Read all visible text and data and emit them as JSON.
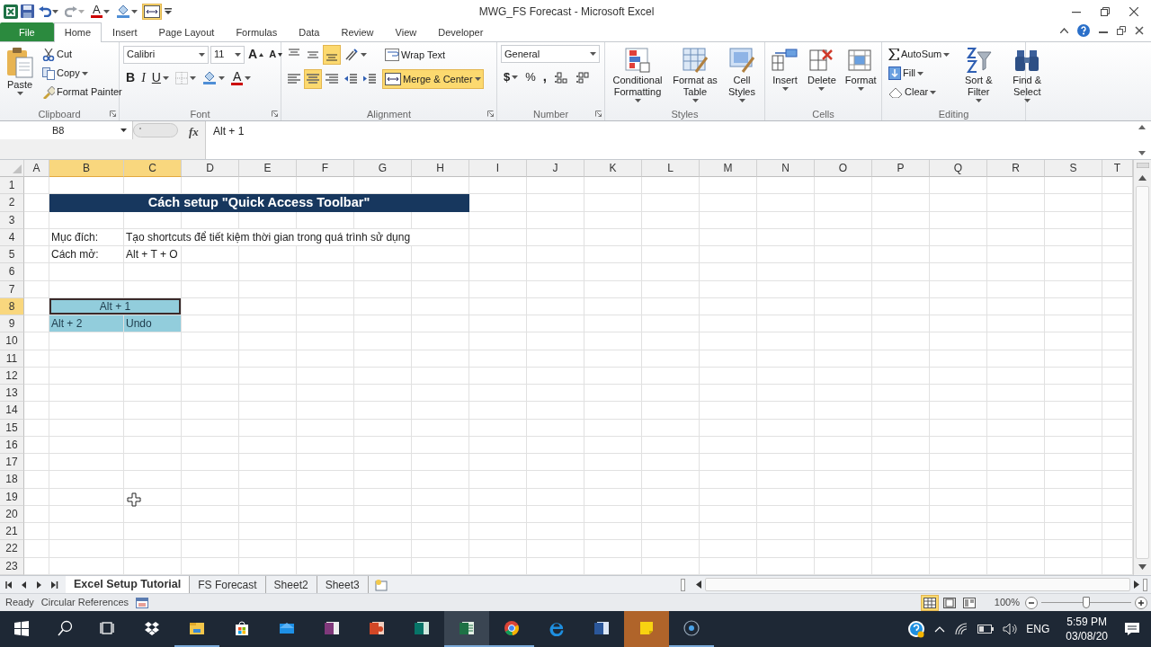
{
  "title_bar": {
    "font_color_glyph": "A",
    "title": "MWG_FS Forecast - Microsoft Excel"
  },
  "menu_tabs": [
    {
      "label": "File",
      "kind": "file",
      "selected": false
    },
    {
      "label": "Home",
      "kind": "tab",
      "selected": true
    },
    {
      "label": "Insert",
      "kind": "tab",
      "selected": false
    },
    {
      "label": "Page Layout",
      "kind": "tab",
      "selected": false
    },
    {
      "label": "Formulas",
      "kind": "tab",
      "selected": false
    },
    {
      "label": "Data",
      "kind": "tab",
      "selected": false
    },
    {
      "label": "Review",
      "kind": "tab",
      "selected": false
    },
    {
      "label": "View",
      "kind": "tab",
      "selected": false
    },
    {
      "label": "Developer",
      "kind": "tab",
      "selected": false
    }
  ],
  "clipboard": {
    "label": "Clipboard",
    "paste": "Paste",
    "cut": "Cut",
    "copy": "Copy",
    "format_painter": "Format Painter"
  },
  "font": {
    "label": "Font",
    "name": "Calibri",
    "size": "11",
    "grow": "A",
    "shrink": "A",
    "bold": "B",
    "italic": "I",
    "underline": "U",
    "font_color": "A"
  },
  "alignment": {
    "label": "Alignment",
    "align_buttons": [
      {
        "on": false
      },
      {
        "on": false
      },
      {
        "on": true
      },
      {
        "on": false
      },
      {
        "on": true
      },
      {
        "on": false
      }
    ],
    "wrap_text": {
      "label": "Wrap Text",
      "on": false
    },
    "merge_center": {
      "label": "Merge & Center",
      "on": true
    }
  },
  "number": {
    "label": "Number",
    "format": "General",
    "currency": "$",
    "percent": "%",
    "comma": ","
  },
  "styles": {
    "label": "Styles",
    "buttons": [
      "Conditional Formatting",
      "Format as Table",
      "Cell Styles"
    ]
  },
  "cells_group": {
    "label": "Cells",
    "buttons": [
      "Insert",
      "Delete",
      "Format"
    ]
  },
  "editing": {
    "label": "Editing",
    "autosum": "AutoSum",
    "fill": "Fill",
    "clear": "Clear",
    "sort_filter": "Sort & Filter",
    "find_select": "Find & Select"
  },
  "formula_bar": {
    "name_box": "B8",
    "fx": "fx",
    "content": "Alt + 1"
  },
  "sheet": {
    "columns": [
      {
        "label": "A",
        "selected": false
      },
      {
        "label": "B",
        "selected": true
      },
      {
        "label": "C",
        "selected": true
      },
      {
        "label": "D",
        "selected": false
      },
      {
        "label": "E",
        "selected": false
      },
      {
        "label": "F",
        "selected": false
      },
      {
        "label": "G",
        "selected": false
      },
      {
        "label": "H",
        "selected": false
      },
      {
        "label": "I",
        "selected": false
      },
      {
        "label": "J",
        "selected": false
      },
      {
        "label": "K",
        "selected": false
      },
      {
        "label": "L",
        "selected": false
      },
      {
        "label": "M",
        "selected": false
      },
      {
        "label": "N",
        "selected": false
      },
      {
        "label": "O",
        "selected": false
      },
      {
        "label": "P",
        "selected": false
      },
      {
        "label": "Q",
        "selected": false
      },
      {
        "label": "R",
        "selected": false
      },
      {
        "label": "S",
        "selected": false
      },
      {
        "label": "T",
        "selected": false
      }
    ],
    "rows": [
      {
        "label": "1",
        "selected": false
      },
      {
        "label": "2",
        "selected": false,
        "cells": [
          {
            "kind": "empty"
          },
          {
            "text": "Cách setup \"Quick Access Toolbar\"",
            "kind": "title"
          },
          {
            "kind": "merged"
          },
          {
            "kind": "merged"
          },
          {
            "kind": "merged"
          },
          {
            "kind": "merged"
          },
          {
            "kind": "merged"
          },
          {
            "kind": "merged"
          }
        ]
      },
      {
        "label": "3",
        "selected": false
      },
      {
        "label": "4",
        "selected": false,
        "cells": [
          {
            "kind": "empty"
          },
          {
            "text": "Mục đích:",
            "kind": "text"
          },
          {
            "text": "Tạo shortcuts để tiết kiệm thời gian trong quá trình sử dụng",
            "kind": "text"
          }
        ]
      },
      {
        "label": "5",
        "selected": false,
        "cells": [
          {
            "kind": "empty"
          },
          {
            "text": "Cách mở:",
            "kind": "text"
          },
          {
            "text": "Alt + T + O",
            "kind": "text"
          }
        ]
      },
      {
        "label": "6",
        "selected": false
      },
      {
        "label": "7",
        "selected": false
      },
      {
        "label": "8",
        "selected": true,
        "cells": [
          {
            "kind": "empty"
          },
          {
            "text": "Alt + 1",
            "kind": "highlight",
            "active": true
          },
          {
            "kind": "merged"
          }
        ]
      },
      {
        "label": "9",
        "selected": false,
        "cells": [
          {
            "kind": "empty"
          },
          {
            "text": "Alt + 2",
            "kind": "highlight"
          },
          {
            "text": "Undo",
            "kind": "highlight"
          }
        ]
      },
      {
        "label": "10",
        "selected": false
      },
      {
        "label": "11",
        "selected": false
      },
      {
        "label": "12",
        "selected": false
      },
      {
        "label": "13",
        "selected": false
      },
      {
        "label": "14",
        "selected": false
      },
      {
        "label": "15",
        "selected": false
      },
      {
        "label": "16",
        "selected": false
      },
      {
        "label": "17",
        "selected": false
      },
      {
        "label": "18",
        "selected": false
      },
      {
        "label": "19",
        "selected": false
      },
      {
        "label": "20",
        "selected": false
      },
      {
        "label": "21",
        "selected": false
      },
      {
        "label": "22",
        "selected": false
      },
      {
        "label": "23",
        "selected": false
      }
    ]
  },
  "sheet_tabs": [
    {
      "label": "Excel Setup Tutorial",
      "selected": true
    },
    {
      "label": "FS Forecast",
      "selected": false
    },
    {
      "label": "Sheet2",
      "selected": false
    },
    {
      "label": "Sheet3",
      "selected": false
    }
  ],
  "status_bar": {
    "ready": "Ready",
    "circular": "Circular References",
    "views": [
      {
        "selected": true
      },
      {
        "selected": false
      },
      {
        "selected": false
      }
    ],
    "zoom": "100%",
    "zoom_slider": {
      "level": 0.5
    }
  },
  "taskbar": {
    "apps": [
      {
        "kind": "start",
        "running": false,
        "active": false,
        "flashing": false
      },
      {
        "kind": "search",
        "running": false,
        "active": false,
        "flashing": false
      },
      {
        "kind": "taskview",
        "running": false,
        "active": false,
        "flashing": false
      },
      {
        "kind": "dropbox",
        "running": false,
        "active": false,
        "flashing": false
      },
      {
        "kind": "explorer",
        "running": true,
        "active": false,
        "flashing": false
      },
      {
        "kind": "store",
        "running": false,
        "active": false,
        "flashing": false
      },
      {
        "kind": "mail",
        "running": false,
        "active": false,
        "flashing": false
      },
      {
        "kind": "onenote",
        "running": false,
        "active": false,
        "flashing": false
      },
      {
        "kind": "powerpoint",
        "running": false,
        "active": false,
        "flashing": false
      },
      {
        "kind": "publisher",
        "running": false,
        "active": false,
        "flashing": false
      },
      {
        "kind": "excel",
        "running": true,
        "active": true,
        "flashing": false
      },
      {
        "kind": "chrome",
        "running": true,
        "active": false,
        "flashing": false
      },
      {
        "kind": "edge",
        "running": false,
        "active": false,
        "flashing": false
      },
      {
        "kind": "word",
        "running": false,
        "active": false,
        "flashing": false
      },
      {
        "kind": "sticky",
        "running": false,
        "active": false,
        "flashing": true
      },
      {
        "kind": "recorder",
        "running": true,
        "active": false,
        "flashing": false
      }
    ],
    "language": "ENG",
    "time": "5:59 PM",
    "date": "03/08/20"
  }
}
